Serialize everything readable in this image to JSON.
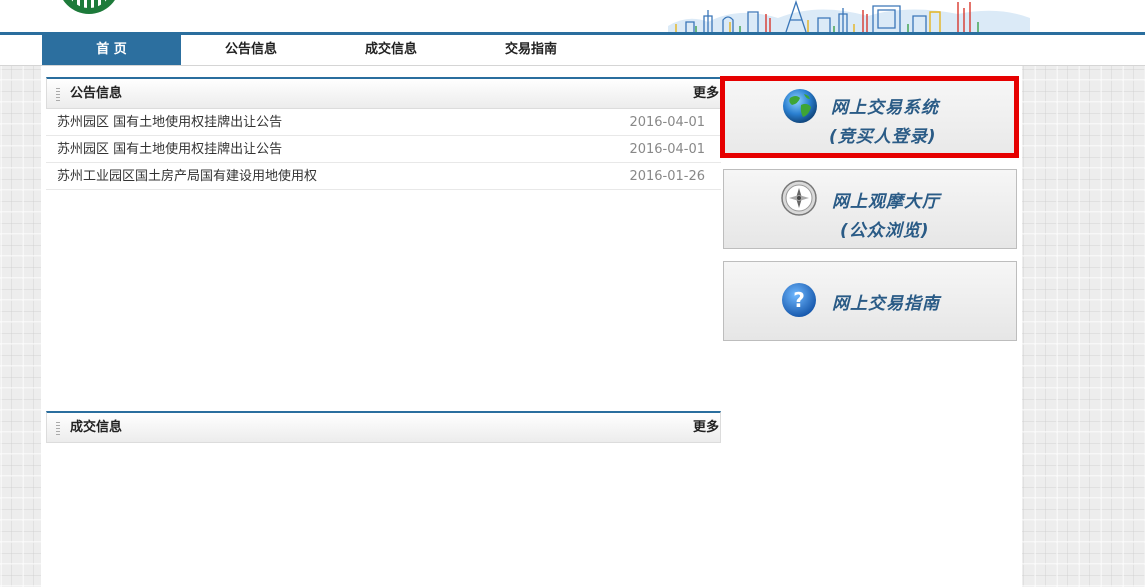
{
  "nav": {
    "items": [
      {
        "label": "首 页",
        "active": true
      },
      {
        "label": "公告信息",
        "active": false
      },
      {
        "label": "成交信息",
        "active": false
      },
      {
        "label": "交易指南",
        "active": false
      }
    ]
  },
  "notices": {
    "title": "公告信息",
    "more": "更多",
    "items": [
      {
        "title": "苏州园区 国有土地使用权挂牌出让公告",
        "date": "2016-04-01"
      },
      {
        "title": "苏州园区 国有土地使用权挂牌出让公告",
        "date": "2016-04-01"
      },
      {
        "title": "苏州工业园区国土房产局国有建设用地使用权",
        "date": "2016-01-26"
      }
    ]
  },
  "deals": {
    "title": "成交信息",
    "more": "更多"
  },
  "side": {
    "online_trading": {
      "line1": "网上交易系统",
      "line2": "(竞买人登录)",
      "icon": "globe-icon"
    },
    "watch_hall": {
      "line1": "网上观摩大厅",
      "line2": "(公众浏览)",
      "icon": "compass-icon"
    },
    "guide": {
      "line1": "网上交易指南",
      "icon": "help-icon"
    }
  },
  "colors": {
    "nav_active": "#2c6f9f",
    "section_rule": "#2a6e9e",
    "highlight_border": "#e60000",
    "side_text": "#2a5b86"
  }
}
